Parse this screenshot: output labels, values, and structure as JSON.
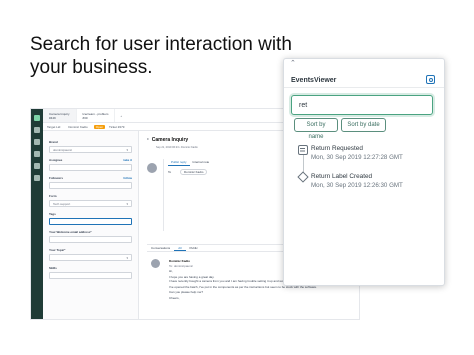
{
  "headline": "Search for user interaction with your business.",
  "app": {
    "tabs": [
      {
        "label": "Camera Inquiry",
        "sub": "#449"
      },
      {
        "label": "Icecream - problem",
        "sub": "#30"
      }
    ],
    "subnav": [
      "Target Ltd",
      "Dominic Kadio",
      "Ticket #479"
    ],
    "subnav_badge": "Open",
    "properties": {
      "brand_label": "Brand",
      "brand_value": "dominicpaunic",
      "assignee_label": "Assignee",
      "take_it": "take it",
      "followers_label": "Followers",
      "follow": "follow",
      "form_label": "Form",
      "form_value": "Tech support",
      "tags_label": "Tags",
      "email_label": "Your Welcome email address*",
      "topic_label": "Your Topic*",
      "skills_label": "Skills"
    },
    "ticket": {
      "title": "Camera Inquiry",
      "meta": "Sep 21, 2019 06:23 • Dominic Kadio",
      "compose_tabs": [
        "Public reply",
        "Internal note"
      ],
      "to_label": "To",
      "to_chip": "Dominic Kadio",
      "conv_tabs": [
        "Conversations",
        "All",
        "Public"
      ],
      "author": "Dominic Kadio",
      "author_sub": "To: dominicpaunic",
      "lines": [
        "Hi,",
        "I hope you are having a great day.",
        "I have recently bought a camera from you and I am having trouble setting it up and wondering if it needs to be adjusted.",
        "I've opened the batch, I've put in the components as per the instructions but seem to be stuck with the software.",
        "Can you please help me?",
        "Cheers,"
      ]
    }
  },
  "events_viewer": {
    "collapse_glyph": "⌃",
    "title": "EventsViewer",
    "search_value": "ret",
    "sort_by_name": "Sort by name",
    "sort_by_date": "Sort by date",
    "events": [
      {
        "title": "Return Requested",
        "time": "Mon, 30 Sep 2019 12:27:28 GMT",
        "icon": "comment-icon"
      },
      {
        "title": "Return Label Created",
        "time": "Mon, 30 Sep 2019 12:26:30 GMT",
        "icon": "tag-icon"
      }
    ]
  }
}
